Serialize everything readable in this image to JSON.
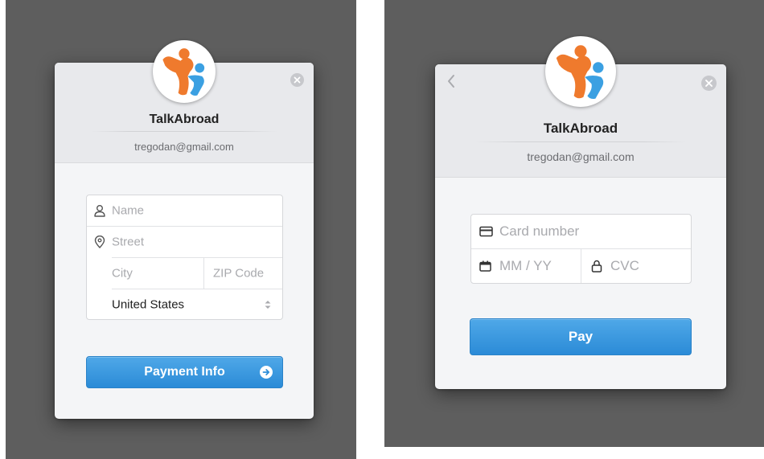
{
  "colors": {
    "backdrop": "#5e5e5e",
    "dialog_body": "#f4f5f7",
    "dialog_header": "#e8e9ec",
    "primary_button": "#3499e0",
    "logo_orange": "#ef7a2d",
    "logo_blue": "#3ba0e2"
  },
  "address_dialog": {
    "app_name": "TalkAbroad",
    "email": "tregodan@gmail.com",
    "logo_icon": "talkabroad-logo",
    "close_icon": "close-icon",
    "fields": {
      "name_placeholder": "Name",
      "name_icon": "user-icon",
      "street_placeholder": "Street",
      "street_icon": "location-pin-icon",
      "city_placeholder": "City",
      "zip_placeholder": "ZIP Code",
      "country_value": "United States",
      "country_icon": "select-arrows-icon"
    },
    "submit_label": "Payment Info",
    "submit_icon": "arrow-right-circle-icon"
  },
  "payment_dialog": {
    "app_name": "TalkAbroad",
    "email": "tregodan@gmail.com",
    "logo_icon": "talkabroad-logo",
    "back_icon": "chevron-left-icon",
    "close_icon": "close-icon",
    "fields": {
      "card_number_placeholder": "Card number",
      "card_icon": "credit-card-icon",
      "expiry_placeholder": "MM / YY",
      "expiry_icon": "calendar-icon",
      "cvc_placeholder": "CVC",
      "cvc_icon": "lock-icon"
    },
    "submit_label": "Pay"
  }
}
